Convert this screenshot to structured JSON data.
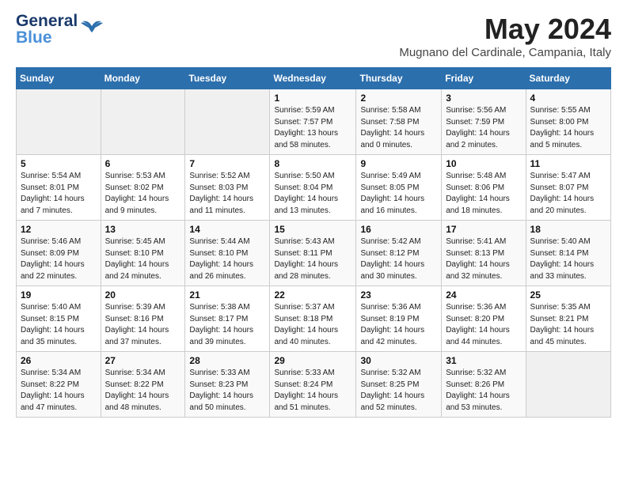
{
  "header": {
    "logo_line1": "General",
    "logo_line2": "Blue",
    "month": "May 2024",
    "location": "Mugnano del Cardinale, Campania, Italy"
  },
  "weekdays": [
    "Sunday",
    "Monday",
    "Tuesday",
    "Wednesday",
    "Thursday",
    "Friday",
    "Saturday"
  ],
  "weeks": [
    [
      {
        "day": "",
        "info": ""
      },
      {
        "day": "",
        "info": ""
      },
      {
        "day": "",
        "info": ""
      },
      {
        "day": "1",
        "info": "Sunrise: 5:59 AM\nSunset: 7:57 PM\nDaylight: 13 hours\nand 58 minutes."
      },
      {
        "day": "2",
        "info": "Sunrise: 5:58 AM\nSunset: 7:58 PM\nDaylight: 14 hours\nand 0 minutes."
      },
      {
        "day": "3",
        "info": "Sunrise: 5:56 AM\nSunset: 7:59 PM\nDaylight: 14 hours\nand 2 minutes."
      },
      {
        "day": "4",
        "info": "Sunrise: 5:55 AM\nSunset: 8:00 PM\nDaylight: 14 hours\nand 5 minutes."
      }
    ],
    [
      {
        "day": "5",
        "info": "Sunrise: 5:54 AM\nSunset: 8:01 PM\nDaylight: 14 hours\nand 7 minutes."
      },
      {
        "day": "6",
        "info": "Sunrise: 5:53 AM\nSunset: 8:02 PM\nDaylight: 14 hours\nand 9 minutes."
      },
      {
        "day": "7",
        "info": "Sunrise: 5:52 AM\nSunset: 8:03 PM\nDaylight: 14 hours\nand 11 minutes."
      },
      {
        "day": "8",
        "info": "Sunrise: 5:50 AM\nSunset: 8:04 PM\nDaylight: 14 hours\nand 13 minutes."
      },
      {
        "day": "9",
        "info": "Sunrise: 5:49 AM\nSunset: 8:05 PM\nDaylight: 14 hours\nand 16 minutes."
      },
      {
        "day": "10",
        "info": "Sunrise: 5:48 AM\nSunset: 8:06 PM\nDaylight: 14 hours\nand 18 minutes."
      },
      {
        "day": "11",
        "info": "Sunrise: 5:47 AM\nSunset: 8:07 PM\nDaylight: 14 hours\nand 20 minutes."
      }
    ],
    [
      {
        "day": "12",
        "info": "Sunrise: 5:46 AM\nSunset: 8:09 PM\nDaylight: 14 hours\nand 22 minutes."
      },
      {
        "day": "13",
        "info": "Sunrise: 5:45 AM\nSunset: 8:10 PM\nDaylight: 14 hours\nand 24 minutes."
      },
      {
        "day": "14",
        "info": "Sunrise: 5:44 AM\nSunset: 8:10 PM\nDaylight: 14 hours\nand 26 minutes."
      },
      {
        "day": "15",
        "info": "Sunrise: 5:43 AM\nSunset: 8:11 PM\nDaylight: 14 hours\nand 28 minutes."
      },
      {
        "day": "16",
        "info": "Sunrise: 5:42 AM\nSunset: 8:12 PM\nDaylight: 14 hours\nand 30 minutes."
      },
      {
        "day": "17",
        "info": "Sunrise: 5:41 AM\nSunset: 8:13 PM\nDaylight: 14 hours\nand 32 minutes."
      },
      {
        "day": "18",
        "info": "Sunrise: 5:40 AM\nSunset: 8:14 PM\nDaylight: 14 hours\nand 33 minutes."
      }
    ],
    [
      {
        "day": "19",
        "info": "Sunrise: 5:40 AM\nSunset: 8:15 PM\nDaylight: 14 hours\nand 35 minutes."
      },
      {
        "day": "20",
        "info": "Sunrise: 5:39 AM\nSunset: 8:16 PM\nDaylight: 14 hours\nand 37 minutes."
      },
      {
        "day": "21",
        "info": "Sunrise: 5:38 AM\nSunset: 8:17 PM\nDaylight: 14 hours\nand 39 minutes."
      },
      {
        "day": "22",
        "info": "Sunrise: 5:37 AM\nSunset: 8:18 PM\nDaylight: 14 hours\nand 40 minutes."
      },
      {
        "day": "23",
        "info": "Sunrise: 5:36 AM\nSunset: 8:19 PM\nDaylight: 14 hours\nand 42 minutes."
      },
      {
        "day": "24",
        "info": "Sunrise: 5:36 AM\nSunset: 8:20 PM\nDaylight: 14 hours\nand 44 minutes."
      },
      {
        "day": "25",
        "info": "Sunrise: 5:35 AM\nSunset: 8:21 PM\nDaylight: 14 hours\nand 45 minutes."
      }
    ],
    [
      {
        "day": "26",
        "info": "Sunrise: 5:34 AM\nSunset: 8:22 PM\nDaylight: 14 hours\nand 47 minutes."
      },
      {
        "day": "27",
        "info": "Sunrise: 5:34 AM\nSunset: 8:22 PM\nDaylight: 14 hours\nand 48 minutes."
      },
      {
        "day": "28",
        "info": "Sunrise: 5:33 AM\nSunset: 8:23 PM\nDaylight: 14 hours\nand 50 minutes."
      },
      {
        "day": "29",
        "info": "Sunrise: 5:33 AM\nSunset: 8:24 PM\nDaylight: 14 hours\nand 51 minutes."
      },
      {
        "day": "30",
        "info": "Sunrise: 5:32 AM\nSunset: 8:25 PM\nDaylight: 14 hours\nand 52 minutes."
      },
      {
        "day": "31",
        "info": "Sunrise: 5:32 AM\nSunset: 8:26 PM\nDaylight: 14 hours\nand 53 minutes."
      },
      {
        "day": "",
        "info": ""
      }
    ]
  ]
}
